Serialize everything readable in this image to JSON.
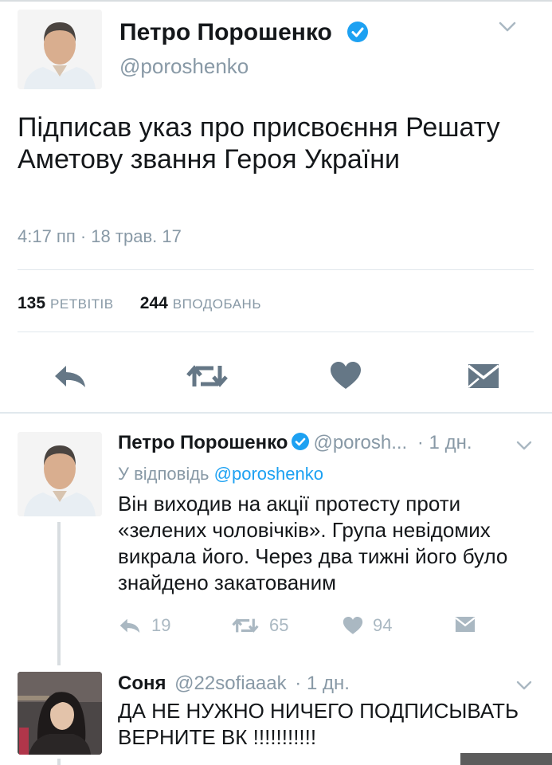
{
  "main_tweet": {
    "author_name": "Петро Порошенко",
    "handle": "@poroshenko",
    "text": "Підписав указ про присвоєння Решату Аметову звання  Героя України",
    "timestamp": "4:17 пп · 18 трав. 17",
    "retweets_count": "135",
    "retweets_label": "РЕТВІТІВ",
    "likes_count": "244",
    "likes_label": "ВПОДОБАНЬ",
    "actions": [
      "reply-icon",
      "retweet-icon",
      "heart-icon",
      "message-icon"
    ]
  },
  "reply1": {
    "author_name": "Петро Порошенко",
    "handle": "@porosh...",
    "time": "· 1 дн.",
    "reply_to_label": "У відповідь",
    "reply_to_handle": "@poroshenko",
    "text": "Він виходив на акції протесту проти «зелених чоловічків». Група невідомих викрала його. Через два тижні його було знайдено закатованим",
    "replies": "19",
    "retweets": "65",
    "likes": "94"
  },
  "reply2": {
    "author_name": "Соня",
    "handle": "@22sofiaaak",
    "time": "· 1 дн.",
    "text": "ДА НЕ НУЖНО НИЧЕГО ПОДПИСЫВАТЬ ВЕРНИТЕ ВК !!!!!!!!!!!"
  },
  "colors": {
    "accent": "#1da1f2",
    "muted": "#8899a6",
    "icon_main": "#657786",
    "icon_light": "#aab8c2",
    "divider": "#e1e8ed"
  }
}
